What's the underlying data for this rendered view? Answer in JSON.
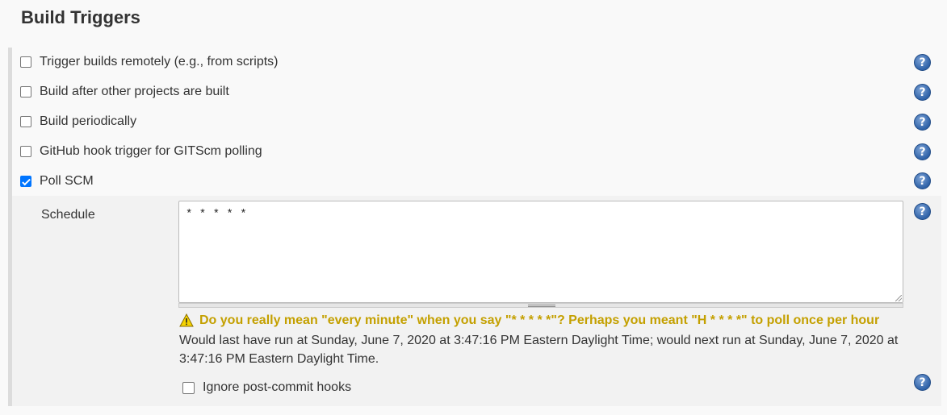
{
  "section": {
    "title": "Build Triggers"
  },
  "triggers": [
    {
      "label": "Trigger builds remotely (e.g., from scripts)",
      "checked": false
    },
    {
      "label": "Build after other projects are built",
      "checked": false
    },
    {
      "label": "Build periodically",
      "checked": false
    },
    {
      "label": "GitHub hook trigger for GITScm polling",
      "checked": false
    },
    {
      "label": "Poll SCM",
      "checked": true
    }
  ],
  "poll_scm": {
    "schedule_label": "Schedule",
    "schedule_value": "* * * * *",
    "warning": "Do you really mean \"every minute\" when you say \"* * * * *\"? Perhaps you meant \"H * * * *\" to poll once per hour",
    "info": "Would last have run at Sunday, June 7, 2020 at 3:47:16 PM Eastern Daylight Time; would next run at Sunday, June 7, 2020 at 3:47:16 PM Eastern Daylight Time.",
    "ignore_hooks_label": "Ignore post-commit hooks",
    "ignore_hooks_checked": false
  },
  "icons": {
    "help": "help-icon",
    "warning": "warning-icon"
  },
  "help_glyph": "?",
  "colors": {
    "checkbox_checked": "#0075ff",
    "warning_text": "#c4a000",
    "help_icon": "#2f62a8"
  }
}
